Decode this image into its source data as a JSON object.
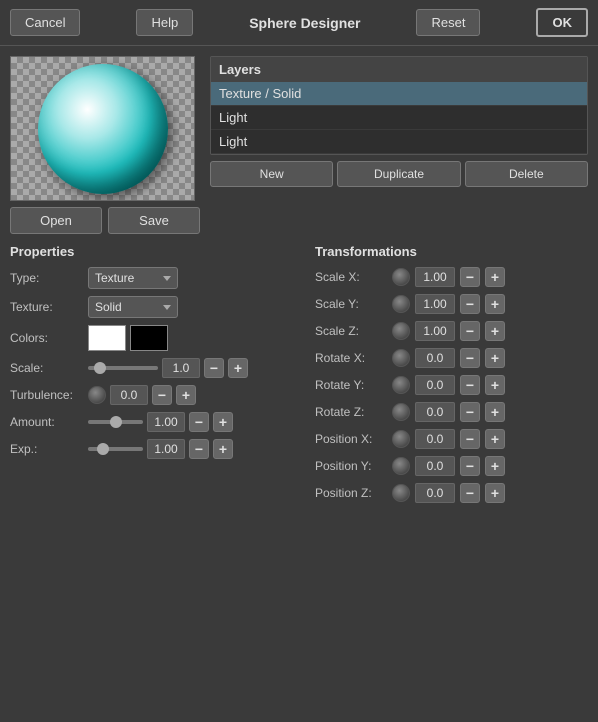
{
  "header": {
    "cancel_label": "Cancel",
    "help_label": "Help",
    "title": "Sphere Designer",
    "reset_label": "Reset",
    "ok_label": "OK"
  },
  "layers": {
    "title": "Layers",
    "items": [
      {
        "label": "Texture / Solid",
        "selected": true
      },
      {
        "label": "Light",
        "selected": false
      },
      {
        "label": "Light",
        "selected": false
      }
    ],
    "buttons": {
      "open": "Open",
      "save": "Save",
      "new": "New",
      "duplicate": "Duplicate",
      "delete": "Delete"
    }
  },
  "properties": {
    "title": "Properties",
    "type_label": "Type:",
    "type_value": "Texture",
    "texture_label": "Texture:",
    "texture_value": "Solid",
    "colors_label": "Colors:",
    "scale_label": "Scale:",
    "scale_value": "1.0",
    "turbulence_label": "Turbulence:",
    "turbulence_value": "0.0",
    "amount_label": "Amount:",
    "amount_value": "1.00",
    "exp_label": "Exp.:",
    "exp_value": "1.00"
  },
  "transformations": {
    "title": "Transformations",
    "scale_x_label": "Scale X:",
    "scale_x_value": "1.00",
    "scale_y_label": "Scale Y:",
    "scale_y_value": "1.00",
    "scale_z_label": "Scale Z:",
    "scale_z_value": "1.00",
    "rotate_x_label": "Rotate X:",
    "rotate_x_value": "0.0",
    "rotate_y_label": "Rotate Y:",
    "rotate_y_value": "0.0",
    "rotate_z_label": "Rotate Z:",
    "rotate_z_value": "0.0",
    "position_x_label": "Position X:",
    "position_x_value": "0.0",
    "position_y_label": "Position Y:",
    "position_y_value": "0.0",
    "position_z_label": "Position Z:",
    "position_z_value": "0.0"
  }
}
